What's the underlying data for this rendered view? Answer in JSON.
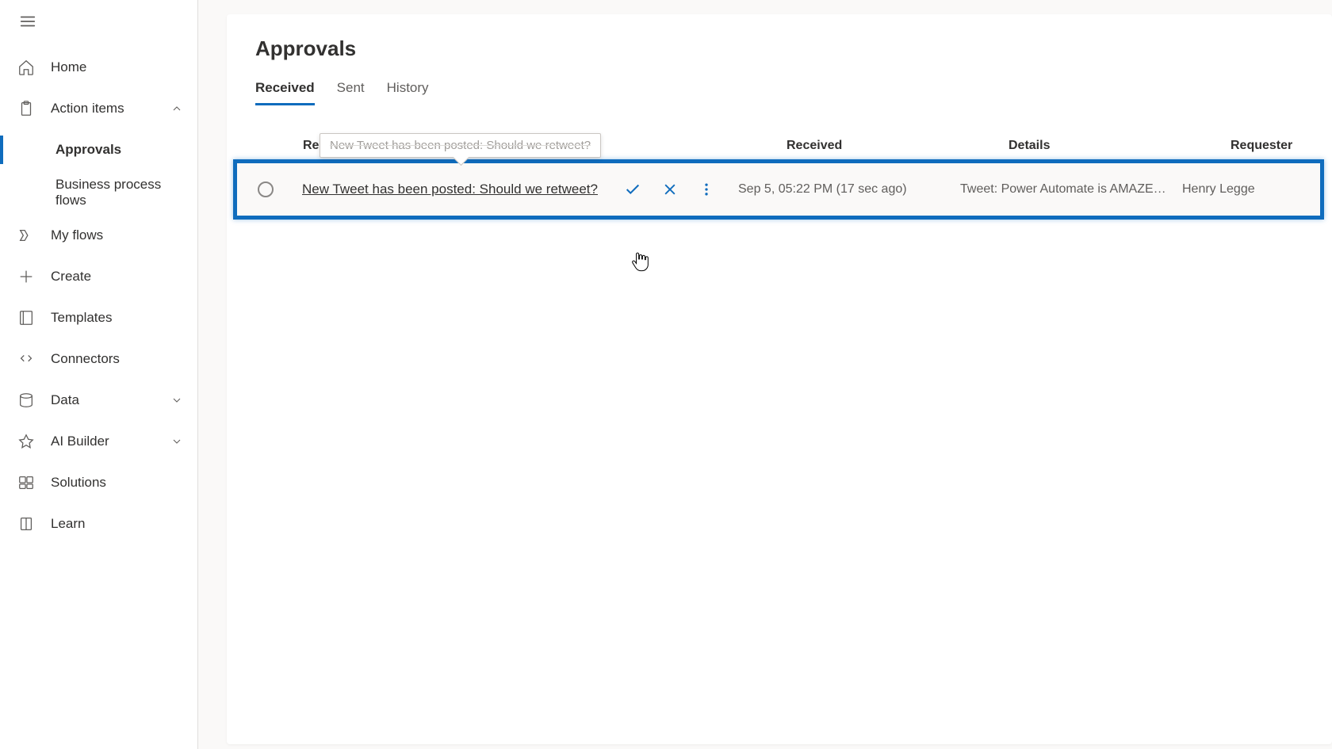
{
  "sidebar": {
    "items": {
      "home": "Home",
      "action_items": "Action items",
      "approvals": "Approvals",
      "bpf": "Business process flows",
      "my_flows": "My flows",
      "create": "Create",
      "templates": "Templates",
      "connectors": "Connectors",
      "data": "Data",
      "ai_builder": "AI Builder",
      "solutions": "Solutions",
      "learn": "Learn"
    }
  },
  "page": {
    "title": "Approvals",
    "tabs": {
      "received": "Received",
      "sent": "Sent",
      "history": "History"
    }
  },
  "columns": {
    "request": "Request",
    "received": "Received",
    "details": "Details",
    "requester": "Requester"
  },
  "tooltip": "New Tweet has been posted: Should we retweet?",
  "rows": [
    {
      "title": "New Tweet has been posted: Should we retweet?",
      "received": "Sep 5, 05:22 PM (17 sec ago)",
      "details": "Tweet: Power Automate is AMAZEBA…",
      "requester": "Henry Legge"
    }
  ]
}
